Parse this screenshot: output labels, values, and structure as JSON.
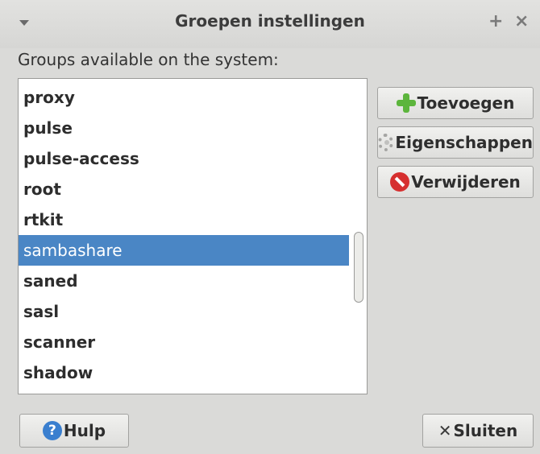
{
  "window": {
    "title": "Groepen instellingen",
    "menu_icon": "chevron-down-icon",
    "pin_icon": "plus-icon",
    "close_icon": "close-icon",
    "pin_glyph": "+",
    "close_glyph": "×"
  },
  "main": {
    "groups_label": "Groups available on the system:",
    "groups": [
      "proxy",
      "pulse",
      "pulse-access",
      "root",
      "rtkit",
      "sambashare",
      "saned",
      "sasl",
      "scanner",
      "shadow"
    ],
    "selected_group": "sambashare",
    "selection_color": "#4a86c5"
  },
  "actions": {
    "add_label": "Toevoegen",
    "properties_label": "Eigenschappen",
    "delete_label": "Verwijderen"
  },
  "footer": {
    "help_label": "Hulp",
    "help_glyph": "?",
    "close_label": "Sluiten",
    "close_glyph": "✕"
  }
}
